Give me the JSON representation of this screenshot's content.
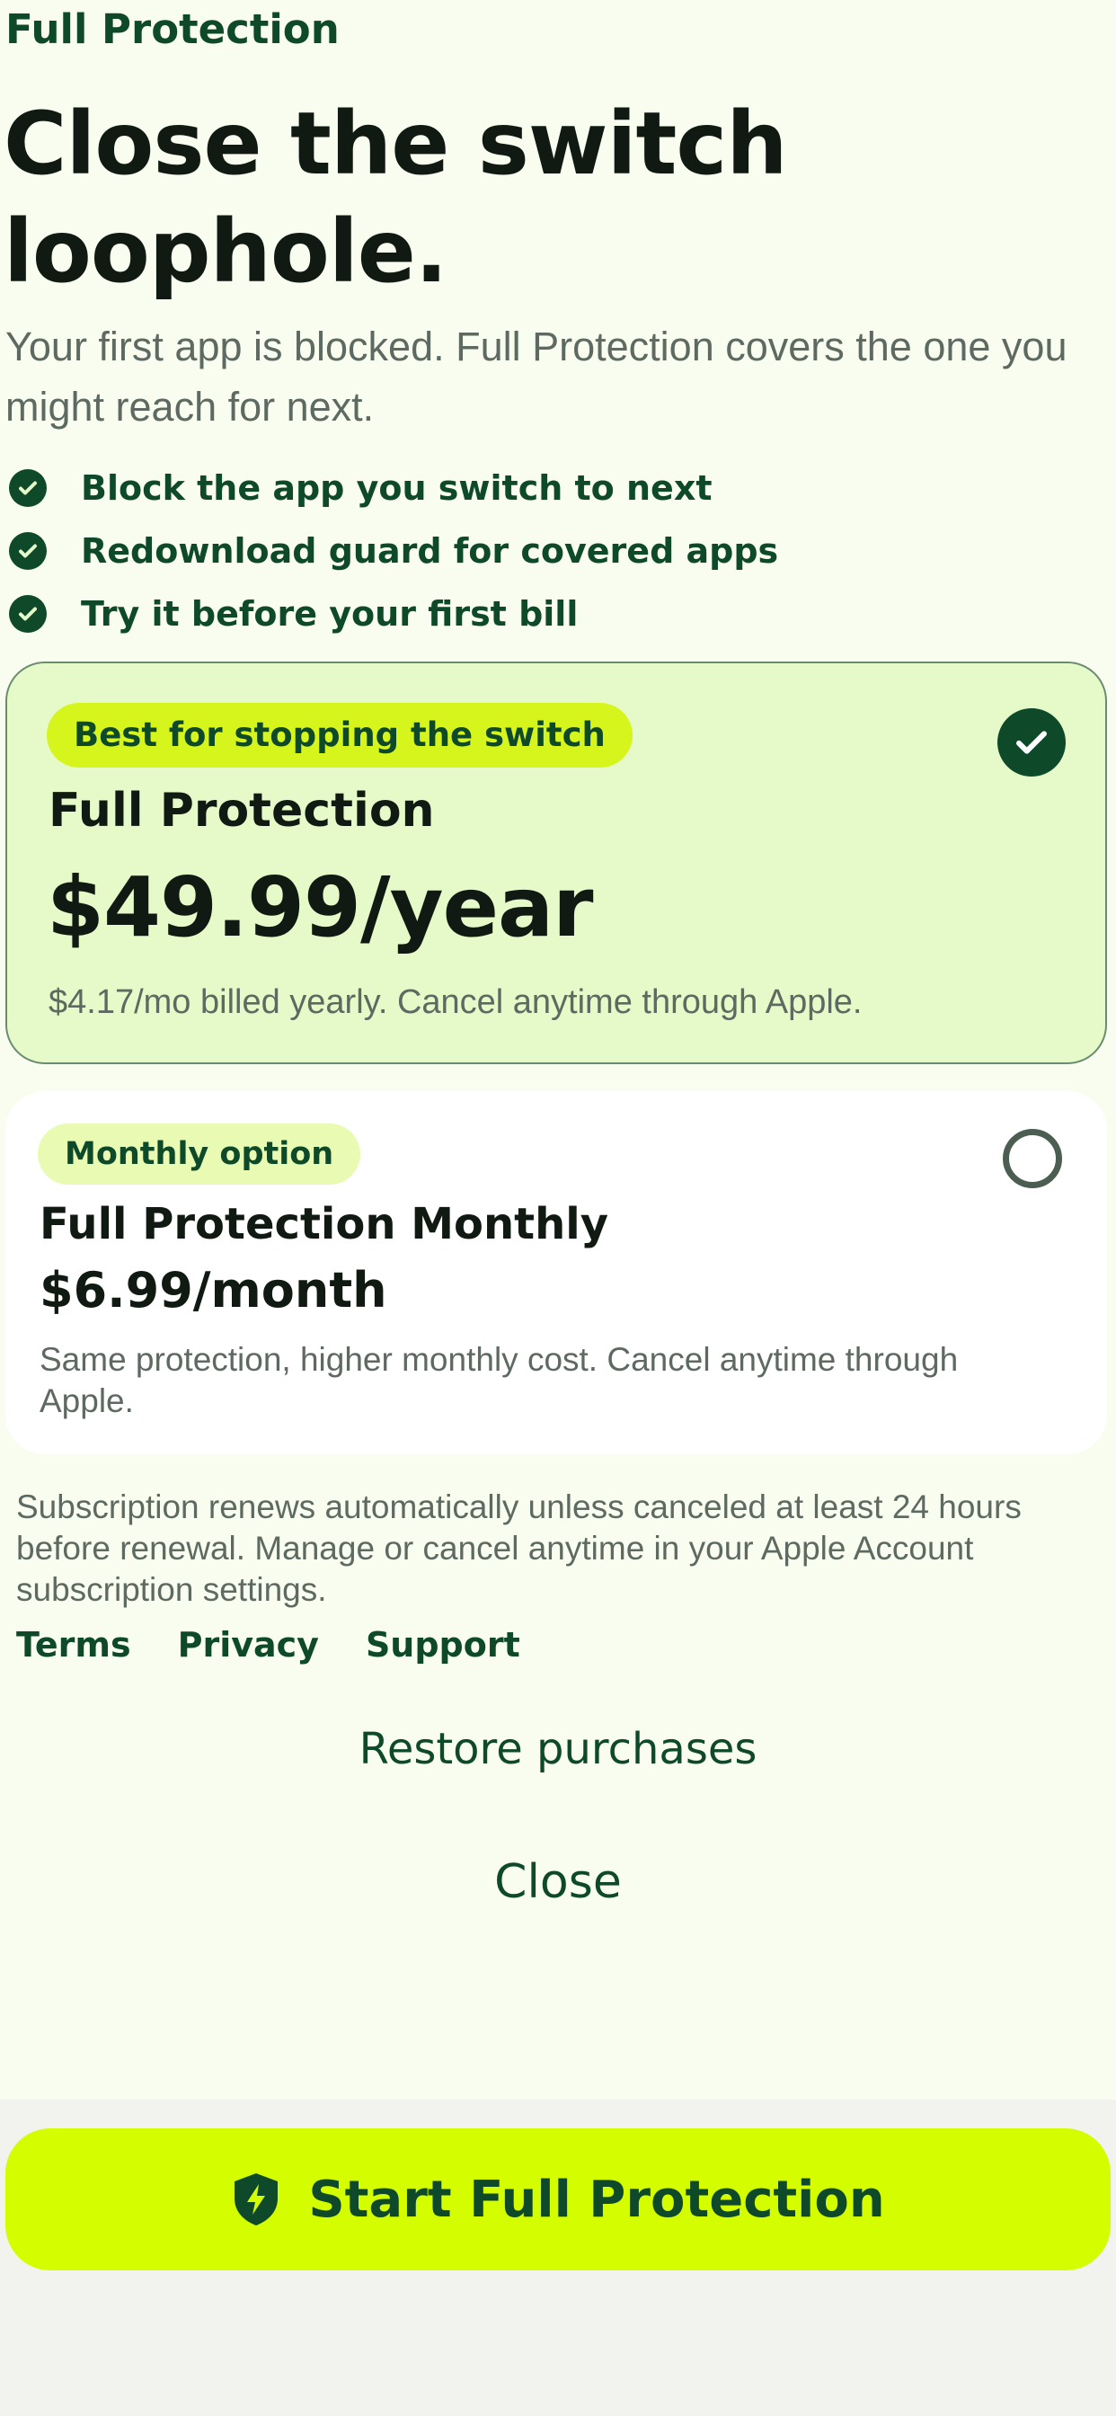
{
  "header": {
    "eyebrow": "Full Protection",
    "headline_line1": "Close the switch",
    "headline_line2": "loophole.",
    "subtitle": "Your first app is blocked. Full Protection covers the one you might reach for next."
  },
  "features": [
    {
      "label": "Block the app you switch to next",
      "icon": "check-circle-icon"
    },
    {
      "label": "Redownload guard for covered apps",
      "icon": "check-circle-icon"
    },
    {
      "label": "Try it before your first bill",
      "icon": "check-circle-icon"
    }
  ],
  "plans": {
    "yearly": {
      "badge": "Best for stopping the switch",
      "name": "Full Protection",
      "price": "$49.99/year",
      "description": "$4.17/mo billed yearly. Cancel anytime through Apple.",
      "selected": true
    },
    "monthly": {
      "badge": "Monthly option",
      "name": "Full Protection Monthly",
      "price": "$6.99/month",
      "description": "Same protection, higher monthly cost. Cancel anytime through Apple.",
      "selected": false
    }
  },
  "legal": {
    "text": "Subscription renews automatically unless canceled at least 24 hours before renewal. Manage or cancel anytime in your Apple Account subscription settings.",
    "links": [
      "Terms",
      "Privacy",
      "Support"
    ]
  },
  "actions": {
    "restore": "Restore purchases",
    "close": "Close",
    "cta": "Start Full Protection",
    "cta_icon": "shield-bolt-icon"
  },
  "colors": {
    "accent": "#d4fd00",
    "brand_dark": "#0e4a2a",
    "background": "#f8fdef",
    "selected_card": "#e5fac8"
  }
}
